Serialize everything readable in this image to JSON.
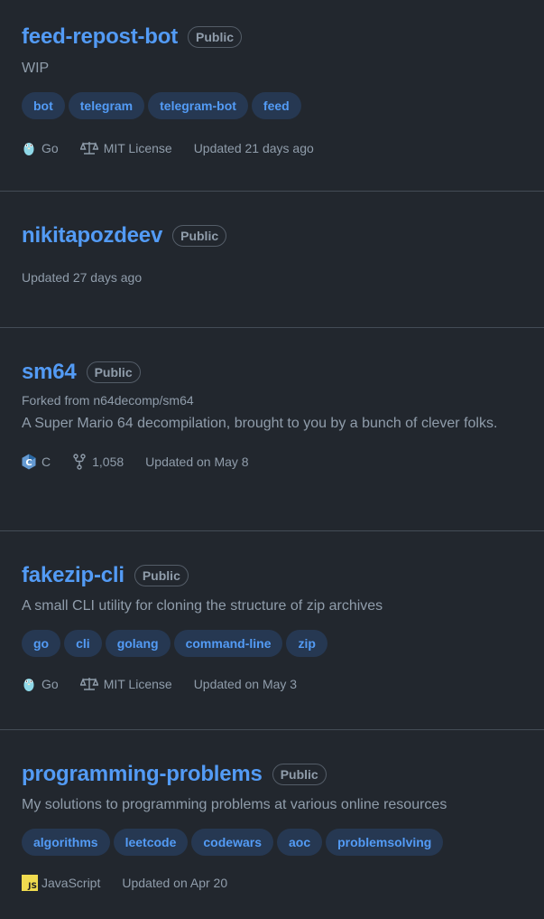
{
  "repos": [
    {
      "name": "feed-repost-bot",
      "visibility": "Public",
      "description": "WIP",
      "topics": [
        "bot",
        "telegram",
        "telegram-bot",
        "feed"
      ],
      "language": "Go",
      "language_icon": "go-gopher-icon",
      "license": "MIT License",
      "updated": "Updated 21 days ago"
    },
    {
      "name": "nikitapozdeev",
      "visibility": "Public",
      "updated": "Updated 27 days ago"
    },
    {
      "name": "sm64",
      "visibility": "Public",
      "forked_from": "Forked from n64decomp/sm64",
      "description": "A Super Mario 64 decompilation, brought to you by a bunch of clever folks.",
      "language": "C",
      "language_icon": "c-language-icon",
      "forks": "1,058",
      "updated": "Updated on May 8"
    },
    {
      "name": "fakezip-cli",
      "visibility": "Public",
      "description": "A small CLI utility for cloning the structure of zip archives",
      "topics": [
        "go",
        "cli",
        "golang",
        "command-line",
        "zip"
      ],
      "language": "Go",
      "language_icon": "go-gopher-icon",
      "license": "MIT License",
      "updated": "Updated on May 3"
    },
    {
      "name": "programming-problems",
      "visibility": "Public",
      "description": "My solutions to programming problems at various online resources",
      "topics": [
        "algorithms",
        "leetcode",
        "codewars",
        "aoc",
        "problemsolving"
      ],
      "language": "JavaScript",
      "language_icon": "javascript-icon",
      "language_icon_text": "JS",
      "updated": "Updated on Apr 20"
    }
  ],
  "colors": {
    "background": "#22272e",
    "link": "#539bf5",
    "muted": "#909dab",
    "topic_bg": "#263852",
    "border": "#444c56"
  }
}
